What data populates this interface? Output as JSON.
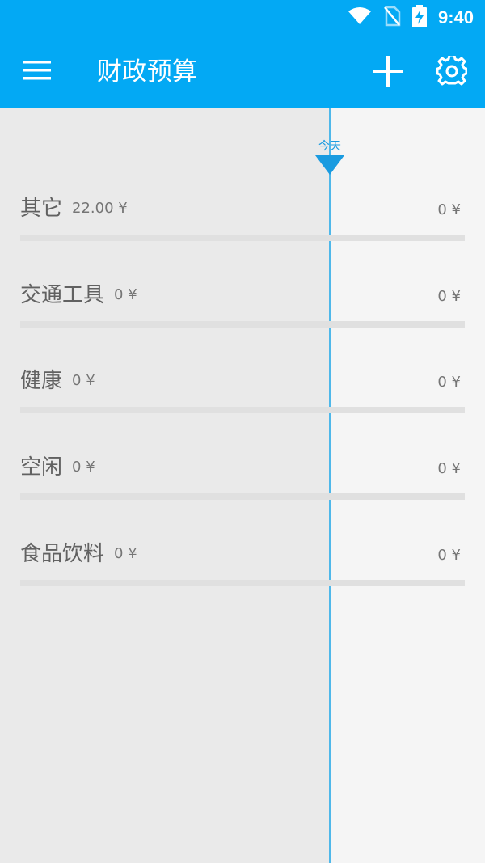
{
  "status_bar": {
    "time": "9:40",
    "icons": [
      "wifi-icon",
      "no-sim-icon",
      "battery-charging-icon"
    ]
  },
  "app_bar": {
    "title": "财政预算",
    "menu_icon": "hamburger-menu-icon",
    "add_icon": "plus-icon",
    "settings_icon": "gear-icon"
  },
  "timeline": {
    "today_label": "今天"
  },
  "categories": [
    {
      "name": "其它",
      "spent": "22.00 ¥",
      "budget": "0 ¥"
    },
    {
      "name": "交通工具",
      "spent": "0 ¥",
      "budget": "0 ¥"
    },
    {
      "name": "健康",
      "spent": "0 ¥",
      "budget": "0 ¥"
    },
    {
      "name": "空闲",
      "spent": "0 ¥",
      "budget": "0 ¥"
    },
    {
      "name": "食品饮料",
      "spent": "0 ¥",
      "budget": "0 ¥"
    }
  ],
  "colors": {
    "primary": "#03a9f4",
    "today_marker": "#1a9be0",
    "past_background": "#eaeaea",
    "future_background": "#f5f5f5"
  }
}
